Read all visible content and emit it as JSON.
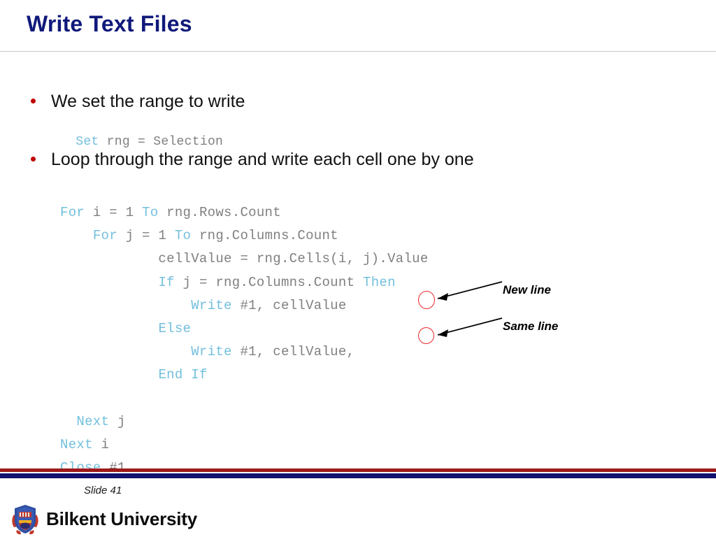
{
  "slide": {
    "title": "Write Text Files",
    "bullets": [
      {
        "text": "We set the range to write"
      },
      {
        "text": "Loop through the range and write each cell one by one"
      }
    ],
    "snippet_set": {
      "keyword": "Set",
      "rest": " rng = Selection"
    },
    "code_lines": [
      [
        {
          "t": "For",
          "k": true
        },
        {
          "t": " i = 1 ",
          "k": false
        },
        {
          "t": "To",
          "k": true
        },
        {
          "t": " rng.Rows.Count",
          "k": false
        }
      ],
      [
        {
          "t": "    ",
          "k": false
        },
        {
          "t": "For",
          "k": true
        },
        {
          "t": " j = 1 ",
          "k": false
        },
        {
          "t": "To",
          "k": true
        },
        {
          "t": " rng.Columns.Count",
          "k": false
        }
      ],
      [
        {
          "t": "            cellValue = rng.Cells(i, j).Value",
          "k": false
        }
      ],
      [
        {
          "t": "            ",
          "k": false
        },
        {
          "t": "If",
          "k": true
        },
        {
          "t": " j = rng.Columns.Count ",
          "k": false
        },
        {
          "t": "Then",
          "k": true
        }
      ],
      [
        {
          "t": "                ",
          "k": false
        },
        {
          "t": "Write",
          "k": true
        },
        {
          "t": " #1, cellValue",
          "k": false
        }
      ],
      [
        {
          "t": "            ",
          "k": false
        },
        {
          "t": "Else",
          "k": true
        }
      ],
      [
        {
          "t": "                ",
          "k": false
        },
        {
          "t": "Write",
          "k": true
        },
        {
          "t": " #1, cellValue,",
          "k": false
        }
      ],
      [
        {
          "t": "            ",
          "k": false
        },
        {
          "t": "End If",
          "k": true
        }
      ],
      [
        {
          "t": "",
          "k": false
        }
      ],
      [
        {
          "t": "  ",
          "k": false
        },
        {
          "t": "Next",
          "k": true
        },
        {
          "t": " j",
          "k": false
        }
      ],
      [
        {
          "t": "",
          "k": false
        },
        {
          "t": "Next",
          "k": true
        },
        {
          "t": " i",
          "k": false
        }
      ],
      [
        {
          "t": "",
          "k": false
        },
        {
          "t": "Close",
          "k": true
        },
        {
          "t": " #1",
          "k": false
        }
      ]
    ],
    "annotations": [
      {
        "label": "New line"
      },
      {
        "label": "Same line"
      }
    ]
  },
  "footer": {
    "slide_number": "Slide 41",
    "brand_name": "Bilkent University"
  },
  "colors": {
    "title": "#10197A",
    "bullet": "#C00000",
    "code_keyword": "#73BFDD",
    "code_text": "#808080",
    "marker": "#E8262B",
    "footer_red": "#9E1B1B",
    "footer_navy": "#13126E"
  }
}
